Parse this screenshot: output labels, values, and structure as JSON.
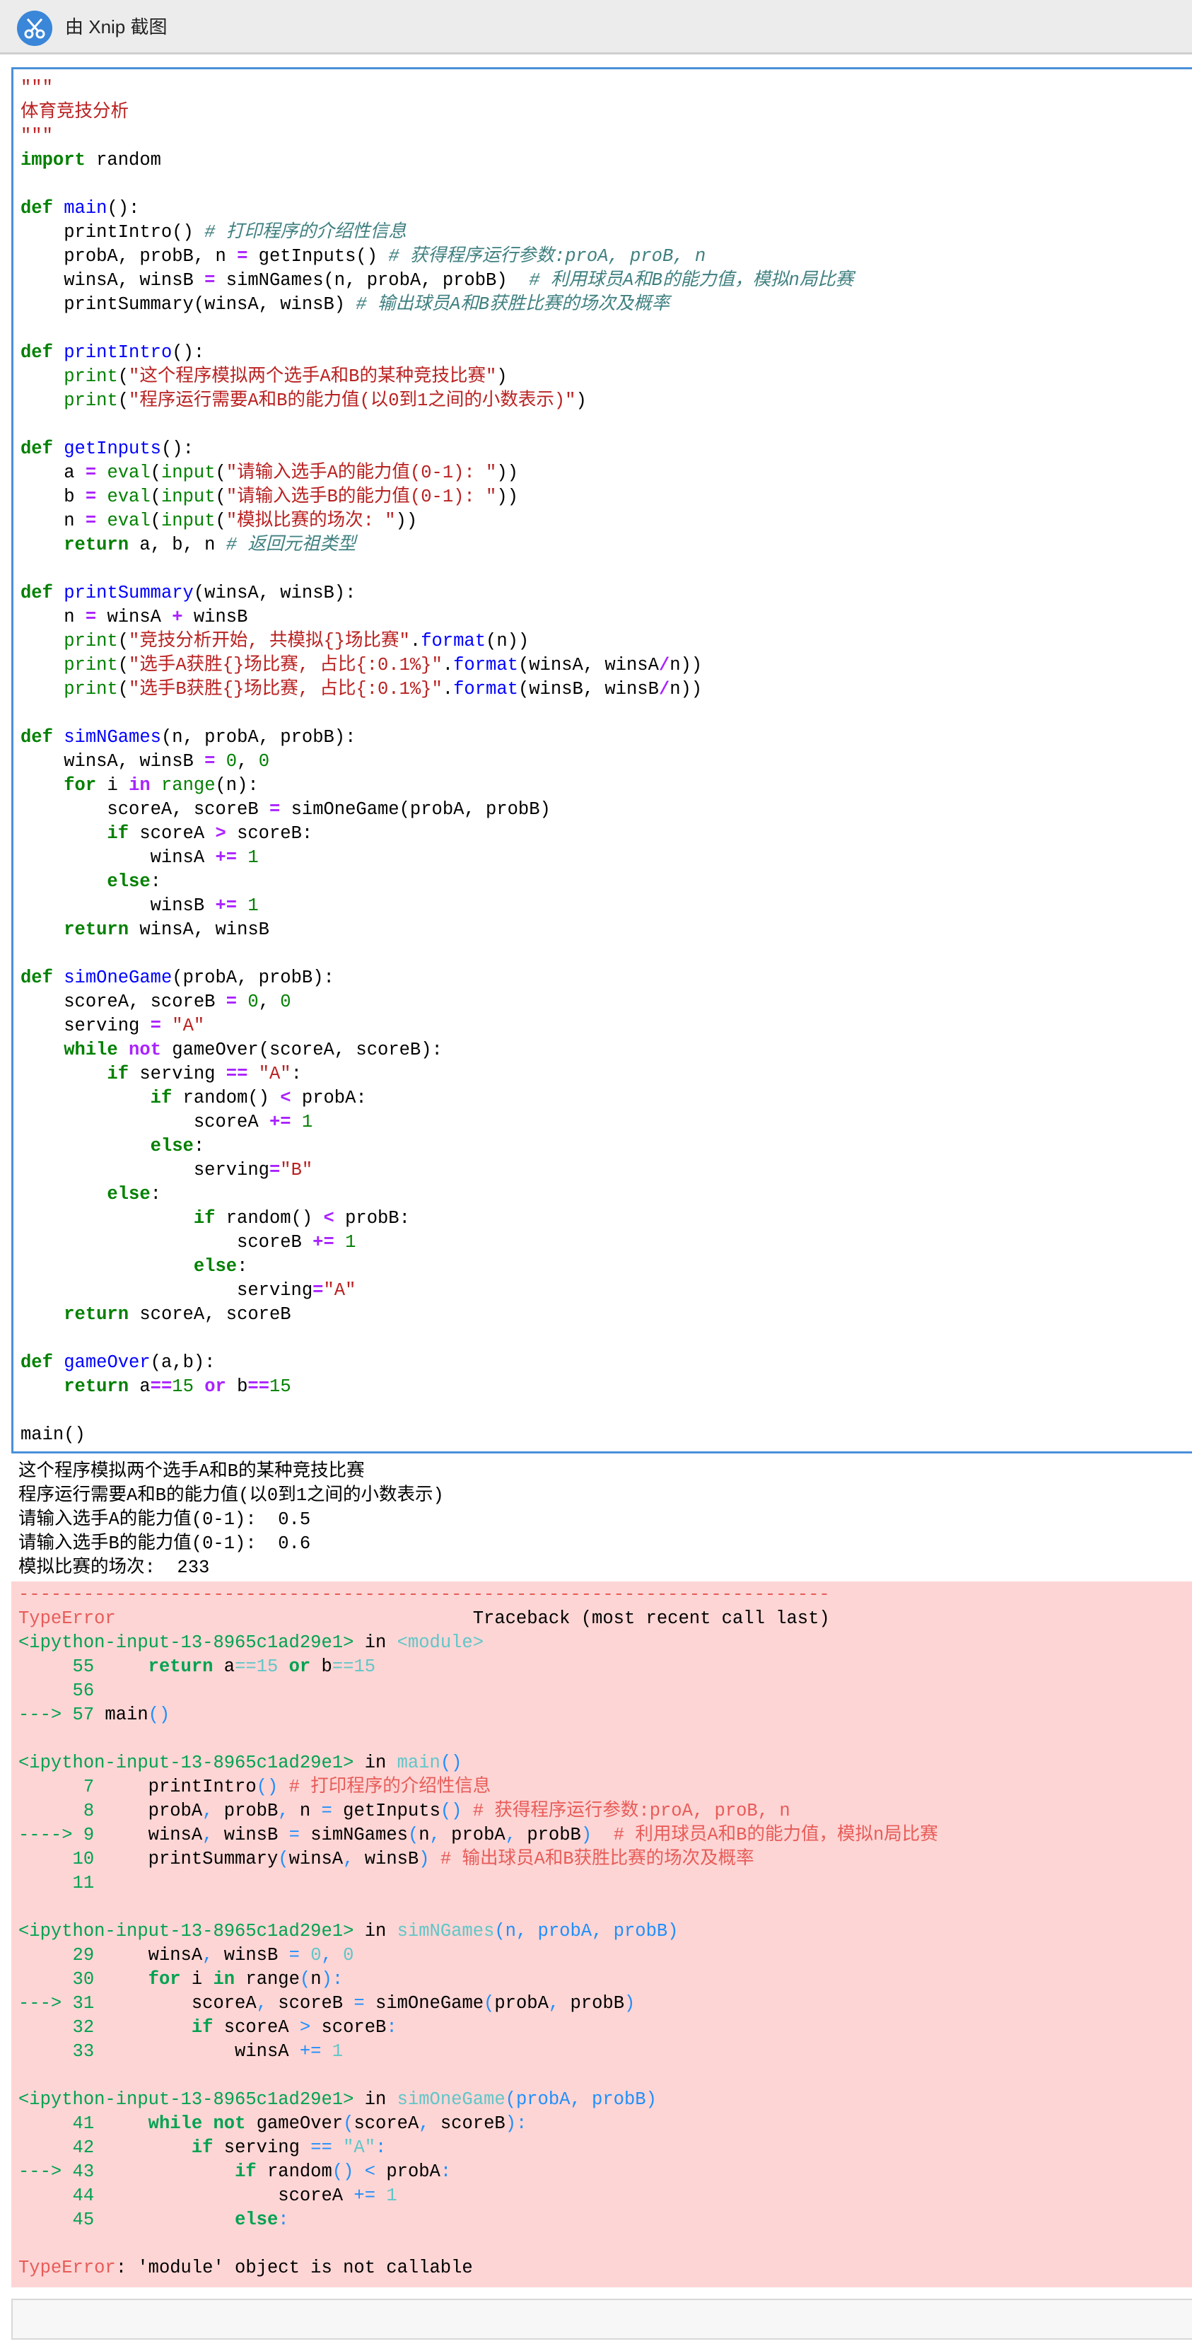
{
  "window": {
    "title": "由 Xnip 截图",
    "icon": "scissors-icon"
  },
  "code": {
    "docstring_open": "\"\"\"",
    "docstring_text": "体育竞技分析",
    "docstring_close": "\"\"\"",
    "lines": [
      "import random",
      "def main():",
      "printIntro()",
      "# 打印程序的介绍性信息",
      "probA, probB, n = getInputs()",
      "# 获得程序运行参数:proA, proB, n",
      "winsA, winsB = simNGames(n, probA, probB)",
      "# 利用球员A和B的能力值，模拟n局比赛",
      "printSummary(winsA, winsB)",
      "# 输出球员A和B获胜比赛的场次及概率"
    ]
  },
  "output": {
    "lines": [
      "这个程序模拟两个选手A和B的某种竞技比赛",
      "程序运行需要A和B的能力值(以0到1之间的小数表示)",
      "请输入选手A的能力值(0-1):  0.5",
      "请输入选手B的能力值(0-1):  0.6",
      "模拟比赛的场次:  233"
    ]
  },
  "error": {
    "type": "TypeError",
    "header": "Traceback (most recent call last)",
    "message": ": 'module' object is not callable",
    "input_ref": "<ipython-input-13-8965c1ad29e1>"
  },
  "colors": {
    "accent": "#4a90d9",
    "error_bg": "#fdd5d5",
    "titlebar_bg": "#ececec"
  }
}
